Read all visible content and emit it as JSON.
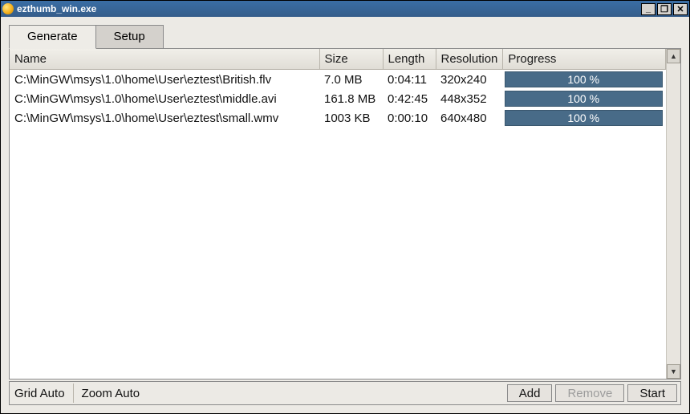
{
  "window": {
    "title": "ezthumb_win.exe"
  },
  "tabs": {
    "generate": "Generate",
    "setup": "Setup",
    "active": "generate"
  },
  "columns": {
    "name": "Name",
    "size": "Size",
    "length": "Length",
    "resolution": "Resolution",
    "progress": "Progress"
  },
  "rows": [
    {
      "name": "C:\\MinGW\\msys\\1.0\\home\\User\\eztest\\British.flv",
      "size": "7.0 MB",
      "length": "0:04:11",
      "resolution": "320x240",
      "progress": "100 %"
    },
    {
      "name": "C:\\MinGW\\msys\\1.0\\home\\User\\eztest\\middle.avi",
      "size": "161.8 MB",
      "length": "0:42:45",
      "resolution": "448x352",
      "progress": "100 %"
    },
    {
      "name": "C:\\MinGW\\msys\\1.0\\home\\User\\eztest\\small.wmv",
      "size": "1003 KB",
      "length": "0:00:10",
      "resolution": "640x480",
      "progress": "100 %"
    }
  ],
  "status": {
    "grid": "Grid Auto",
    "zoom": "Zoom Auto"
  },
  "buttons": {
    "add": "Add",
    "remove": "Remove",
    "start": "Start"
  },
  "glyphs": {
    "min": "_",
    "max": "❐",
    "close": "✕",
    "up": "▲",
    "down": "▼"
  }
}
